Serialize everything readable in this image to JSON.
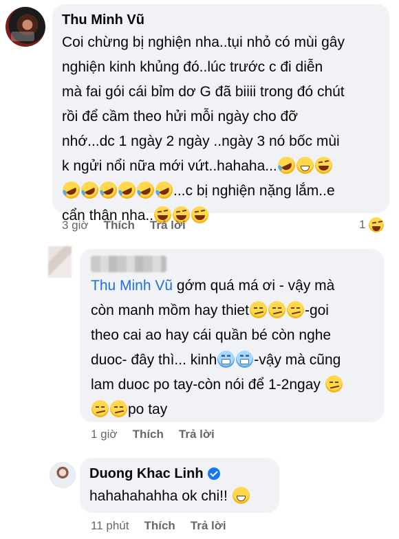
{
  "comments": [
    {
      "author": "Thu Minh Vũ",
      "text_lines": [
        "Coi chừng bị nghiện nha..tụi nhỏ có mùi gây",
        "nghiện kinh khủng đó..lúc trước c đi diễn",
        "mà fai gói cái bỉm dơ G đã biiii trong đó chút",
        "rồi để cầm theo hửi mỗi ngày cho đỡ",
        "nhớ...dc 1 ngày 2 ngày ..ngày 3 nó bốc mùi",
        "k ngửi nổi nữa mới vứt..hahaha...",
        "...c bị nghiện nặng lắm..e",
        "cẩn thận nha.."
      ],
      "time": "3 giờ",
      "like_label": "Thích",
      "reply_label": "Trả lời",
      "reaction_count": "1",
      "reaction_icon": "laughing-emoji-icon"
    },
    {
      "mention": "Thu Minh Vũ",
      "text_lines": [
        " gớm quá má ơi - vậy mà",
        "còn manh mồm hay thiet",
        "-goi",
        "theo cai ao hay cái quần bé còn nghe",
        "duoc- đây thì... kinh",
        "-vậy mà cũng",
        "lam duoc po tay-còn nói để 1-2ngay",
        "po tay"
      ],
      "time": "1 giờ",
      "like_label": "Thích",
      "reply_label": "Trả lời"
    },
    {
      "author": "Duong Khac Linh",
      "text_lines": [
        "hahahahahha ok chi!! "
      ],
      "time": "11 phút",
      "like_label": "Thích",
      "reply_label": "Trả lời"
    }
  ]
}
